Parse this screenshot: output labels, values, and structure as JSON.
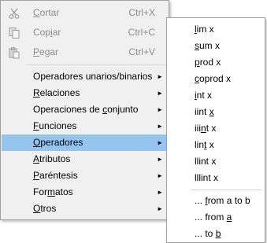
{
  "menu": {
    "items": [
      {
        "label": "Cortar",
        "shortcut": "Ctrl+X",
        "disabled": true,
        "icon": "cut-icon"
      },
      {
        "label": "Copiar",
        "shortcut": "Ctrl+C",
        "disabled": true,
        "icon": "copy-icon"
      },
      {
        "label": "Pegar",
        "shortcut": "Ctrl+V",
        "disabled": true,
        "icon": "paste-icon"
      },
      {
        "label": "Operadores unarios/binarios",
        "submenu": true
      },
      {
        "label": "Relaciones",
        "submenu": true
      },
      {
        "label": "Operaciones de conjunto",
        "submenu": true
      },
      {
        "label": "Funciones",
        "submenu": true
      },
      {
        "label": "Operadores",
        "submenu": true,
        "highlighted": true
      },
      {
        "label": "Atributos",
        "submenu": true
      },
      {
        "label": "Paréntesis",
        "submenu": true
      },
      {
        "label": "Formatos",
        "submenu": true
      },
      {
        "label": "Otros",
        "submenu": true
      }
    ],
    "arrow": "►",
    "highlight_color": "#94c4f0",
    "disabled_color": "#8c8c8c"
  },
  "submenu": {
    "items": [
      {
        "label": "lim x"
      },
      {
        "label": "sum x"
      },
      {
        "label": "prod x"
      },
      {
        "label": "coprod x"
      },
      {
        "label": "int x"
      },
      {
        "label": "iint x"
      },
      {
        "label": "iiint x"
      },
      {
        "label": "lint x"
      },
      {
        "label": "llint x"
      },
      {
        "label": "lllint x"
      },
      {
        "label": "... from a to b"
      },
      {
        "label": "... from a"
      },
      {
        "label": "... to b"
      }
    ]
  }
}
